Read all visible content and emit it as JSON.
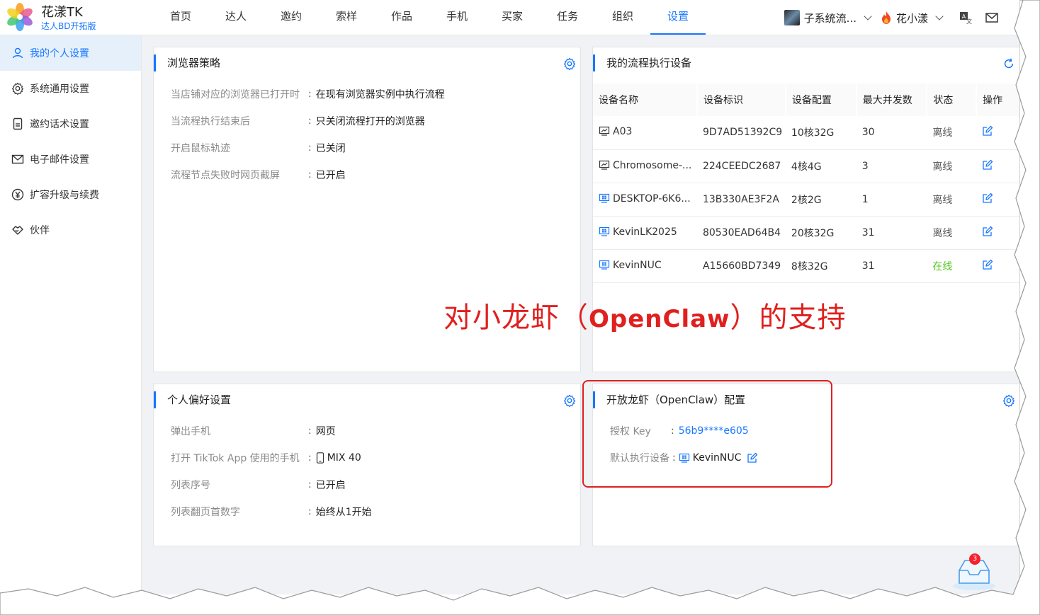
{
  "brand": {
    "title": "花漾TK",
    "subtitle": "达人BD开拓版"
  },
  "nav": [
    {
      "label": "首页"
    },
    {
      "label": "达人"
    },
    {
      "label": "邀约"
    },
    {
      "label": "索样"
    },
    {
      "label": "作品"
    },
    {
      "label": "手机"
    },
    {
      "label": "买家"
    },
    {
      "label": "任务"
    },
    {
      "label": "组织"
    },
    {
      "label": "设置",
      "active": true
    }
  ],
  "header": {
    "team_name": "子系统流...",
    "user_name": "花小漾"
  },
  "sidebar": [
    {
      "label": "我的个人设置",
      "icon": "user-icon",
      "active": true
    },
    {
      "label": "系统通用设置",
      "icon": "gear-icon"
    },
    {
      "label": "邀约话术设置",
      "icon": "document-icon"
    },
    {
      "label": "电子邮件设置",
      "icon": "mail-icon"
    },
    {
      "label": "扩容升级与续费",
      "icon": "yen-icon"
    },
    {
      "label": "伙伴",
      "icon": "handshake-icon"
    }
  ],
  "browser_policy": {
    "title": "浏览器策略",
    "rows": [
      {
        "k": "当店铺对应的浏览器已打开时",
        "v": "在现有浏览器实例中执行流程"
      },
      {
        "k": "当流程执行结束后",
        "v": "只关闭流程打开的浏览器"
      },
      {
        "k": "开启鼠标轨迹",
        "v": "已关闭"
      },
      {
        "k": "流程节点失败时网页截屏",
        "v": "已开启"
      }
    ]
  },
  "devices": {
    "title": "我的流程执行设备",
    "columns": [
      "设备名称",
      "设备标识",
      "设备配置",
      "最大并发数",
      "状态",
      "操作"
    ],
    "rows": [
      {
        "name": "A03",
        "id": "9D7AD51392C9",
        "config": "10核32G",
        "max": "30",
        "status": "离线",
        "os": "mac"
      },
      {
        "name": "Chromosome-...",
        "id": "224CEEDC2687",
        "config": "4核4G",
        "max": "3",
        "status": "离线",
        "os": "mac"
      },
      {
        "name": "DESKTOP-6K6...",
        "id": "13B330AE3F2A",
        "config": "2核2G",
        "max": "1",
        "status": "离线",
        "os": "windows"
      },
      {
        "name": "KevinLK2025",
        "id": "80530EAD64B4",
        "config": "20核32G",
        "max": "31",
        "status": "离线",
        "os": "windows"
      },
      {
        "name": "KevinNUC",
        "id": "A15660BD7349",
        "config": "8核32G",
        "max": "31",
        "status": "在线",
        "os": "windows"
      }
    ]
  },
  "preferences": {
    "title": "个人偏好设置",
    "rows": [
      {
        "k": "弹出手机",
        "v": "网页"
      },
      {
        "k": "打开 TikTok App 使用的手机",
        "v": "MIX 40"
      },
      {
        "k": "列表序号",
        "v": "已开启"
      },
      {
        "k": "列表翻页首数字",
        "v": "始终从1开始"
      }
    ]
  },
  "openclaw": {
    "title": "开放龙虾（OpenClaw）配置",
    "key_label": "授权 Key",
    "key_value": "56b9****e605",
    "device_label": "默认执行设备",
    "device_value": "KevinNUC"
  },
  "annotation": {
    "prefix": "对小龙虾（",
    "brand": "OpenClaw",
    "suffix": "）的支持"
  },
  "inbox_badge": "3",
  "colors": {
    "accent": "#1677ff",
    "online": "#52c41a",
    "annotation": "#e0201e"
  }
}
